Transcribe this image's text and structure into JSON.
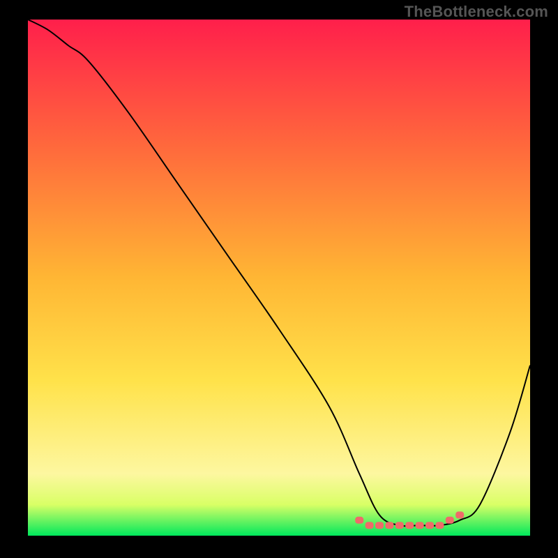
{
  "watermark": "TheBottleneck.com",
  "chart_data": {
    "type": "line",
    "title": "",
    "xlabel": "",
    "ylabel": "",
    "xlim": [
      0,
      100
    ],
    "ylim": [
      0,
      100
    ],
    "background_gradient": {
      "stops": [
        {
          "offset": 0,
          "color": "#ff1f4b"
        },
        {
          "offset": 25,
          "color": "#ff6a3c"
        },
        {
          "offset": 50,
          "color": "#ffb634"
        },
        {
          "offset": 70,
          "color": "#ffe24a"
        },
        {
          "offset": 88,
          "color": "#fdf7a0"
        },
        {
          "offset": 94,
          "color": "#d9ff66"
        },
        {
          "offset": 100,
          "color": "#00e85c"
        }
      ]
    },
    "series": [
      {
        "name": "bottleneck-curve",
        "color": "#000000",
        "x": [
          0,
          4,
          8,
          12,
          20,
          30,
          40,
          50,
          60,
          66,
          70,
          74,
          78,
          82,
          86,
          90,
          96,
          100
        ],
        "values": [
          100,
          98,
          95,
          92,
          82,
          68,
          54,
          40,
          25,
          12,
          4,
          2,
          2,
          2,
          3,
          6,
          20,
          33
        ]
      },
      {
        "name": "optimal-band-markers",
        "color": "#ef6a6a",
        "marker_only": true,
        "x": [
          66,
          68,
          70,
          72,
          74,
          76,
          78,
          80,
          82,
          84,
          86
        ],
        "values": [
          3,
          2,
          2,
          2,
          2,
          2,
          2,
          2,
          2,
          3,
          4
        ]
      }
    ]
  }
}
